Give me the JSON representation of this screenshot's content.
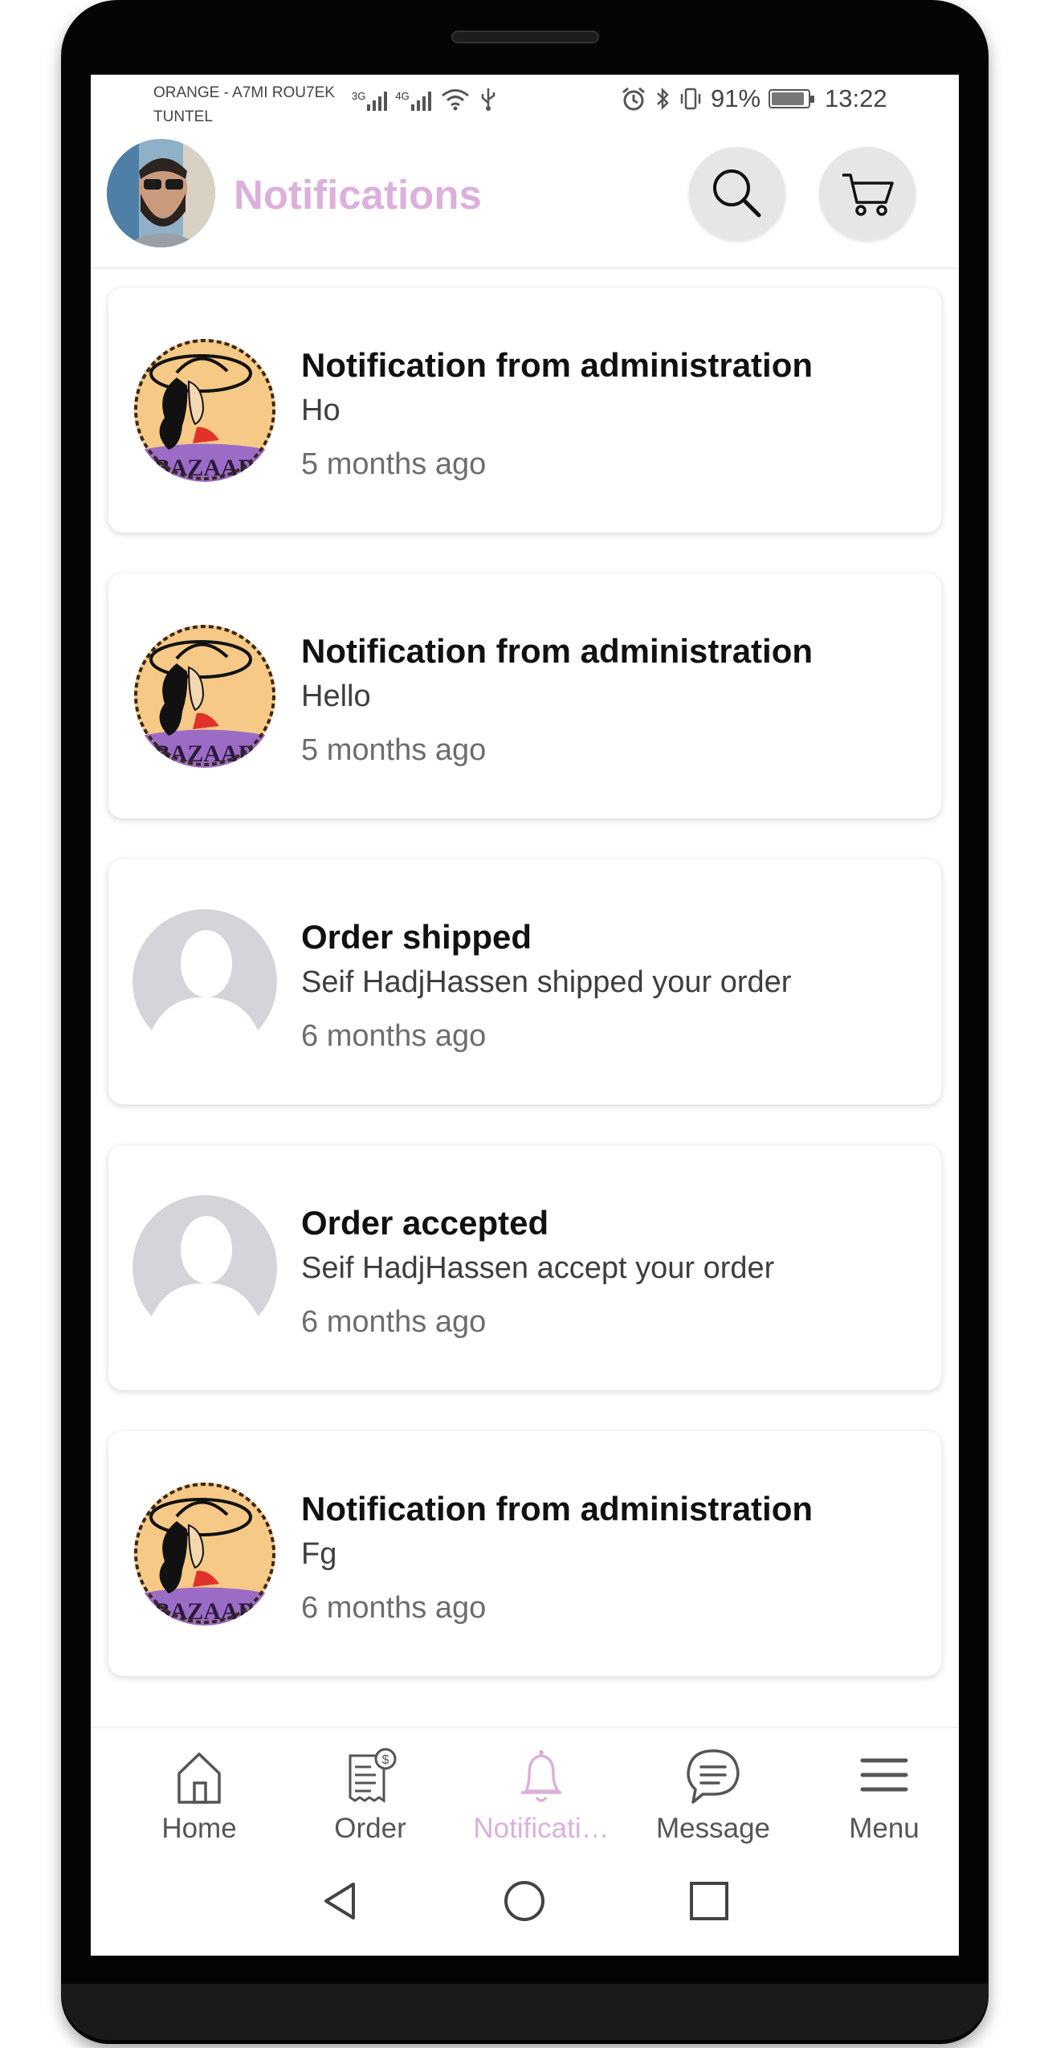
{
  "colors": {
    "accent": "#dbb1dc",
    "text_dark": "#111111",
    "text_muted": "#6d6d6d",
    "nav_inactive": "#555555",
    "placeholder_gray": "#d3d5d9"
  },
  "status_bar": {
    "carrier_line1": "ORANGE - A7MI ROU7EK",
    "carrier_line2": "TUNTEL",
    "net1": "3G",
    "net2": "4G",
    "battery_text": "91%",
    "battery_level": 0.91,
    "time": "13:22",
    "icons": [
      "signal-icon",
      "signal-icon",
      "wifi-icon",
      "usb-icon",
      "alarm-icon",
      "bluetooth-icon",
      "vibrate-icon",
      "battery-icon"
    ]
  },
  "header": {
    "title": "Notifications",
    "avatar": "user-avatar",
    "actions": [
      "search-icon",
      "cart-icon"
    ]
  },
  "notifications": [
    {
      "title": "Notification from administration",
      "body": "Ho",
      "time": "5 months ago",
      "avatar": "bazaar-logo",
      "logo_text": "BAZAAR"
    },
    {
      "title": "Notification from administration",
      "body": "Hello",
      "time": "5 months ago",
      "avatar": "bazaar-logo",
      "logo_text": "BAZAAR"
    },
    {
      "title": "Order shipped",
      "body": "Seif HadjHassen shipped your order",
      "time": "6 months ago",
      "avatar": "default-user"
    },
    {
      "title": "Order accepted",
      "body": "Seif HadjHassen accept your order",
      "time": "6 months ago",
      "avatar": "default-user"
    },
    {
      "title": "Notification from administration",
      "body": "Fg",
      "time": "6 months ago",
      "avatar": "bazaar-logo",
      "logo_text": "BAZAAR"
    }
  ],
  "bottom_nav": {
    "active": "notifications",
    "items": [
      {
        "key": "home",
        "label": "Home",
        "icon": "home-icon"
      },
      {
        "key": "order",
        "label": "Order",
        "icon": "receipt-icon"
      },
      {
        "key": "notifications",
        "label": "Notificati…",
        "icon": "bell-icon"
      },
      {
        "key": "message",
        "label": "Message",
        "icon": "chat-icon"
      },
      {
        "key": "menu",
        "label": "Menu",
        "icon": "hamburger-icon"
      }
    ]
  },
  "system_nav": [
    "back-icon",
    "home-circle-icon",
    "recents-icon"
  ]
}
